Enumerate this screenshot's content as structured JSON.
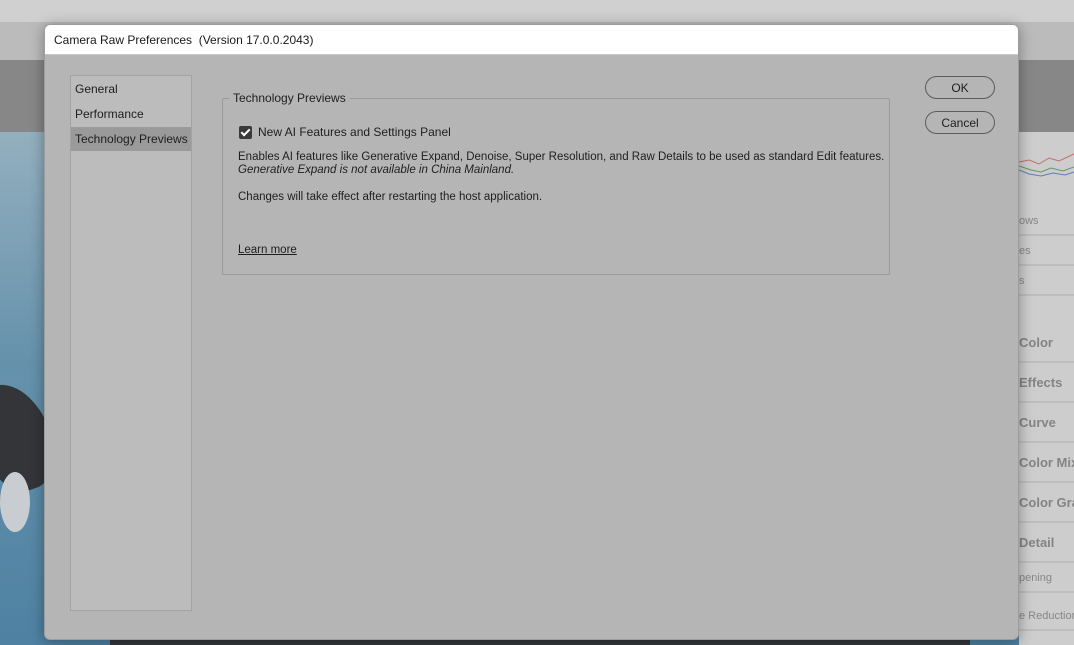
{
  "dialog": {
    "title": "Camera Raw Preferences  (Version 17.0.0.2043)",
    "ok_label": "OK",
    "cancel_label": "Cancel"
  },
  "nav": {
    "items": [
      {
        "label": "General",
        "selected": false
      },
      {
        "label": "Performance",
        "selected": false
      },
      {
        "label": "Technology Previews",
        "selected": true
      }
    ]
  },
  "tech_previews": {
    "group_title": "Technology Previews",
    "checkbox_label": "New AI Features and Settings Panel",
    "checkbox_checked": true,
    "description": "Enables AI features like Generative Expand, Denoise, Super Resolution, and Raw Details to be used as standard Edit features.",
    "note": "Generative Expand is not available in China Mainland.",
    "restart_notice": "Changes will take effect after restarting the host application.",
    "learn_more_label": "Learn more"
  },
  "background_panel": {
    "rows": [
      {
        "label": "ows"
      },
      {
        "label": "es"
      },
      {
        "label": "s"
      },
      {
        "label": "Color"
      },
      {
        "label": "Effects"
      },
      {
        "label": "Curve"
      },
      {
        "label": "Color Mix"
      },
      {
        "label": "Color Grad"
      },
      {
        "label": "Detail"
      },
      {
        "label": "pening"
      },
      {
        "label": "e Reduction"
      }
    ]
  }
}
